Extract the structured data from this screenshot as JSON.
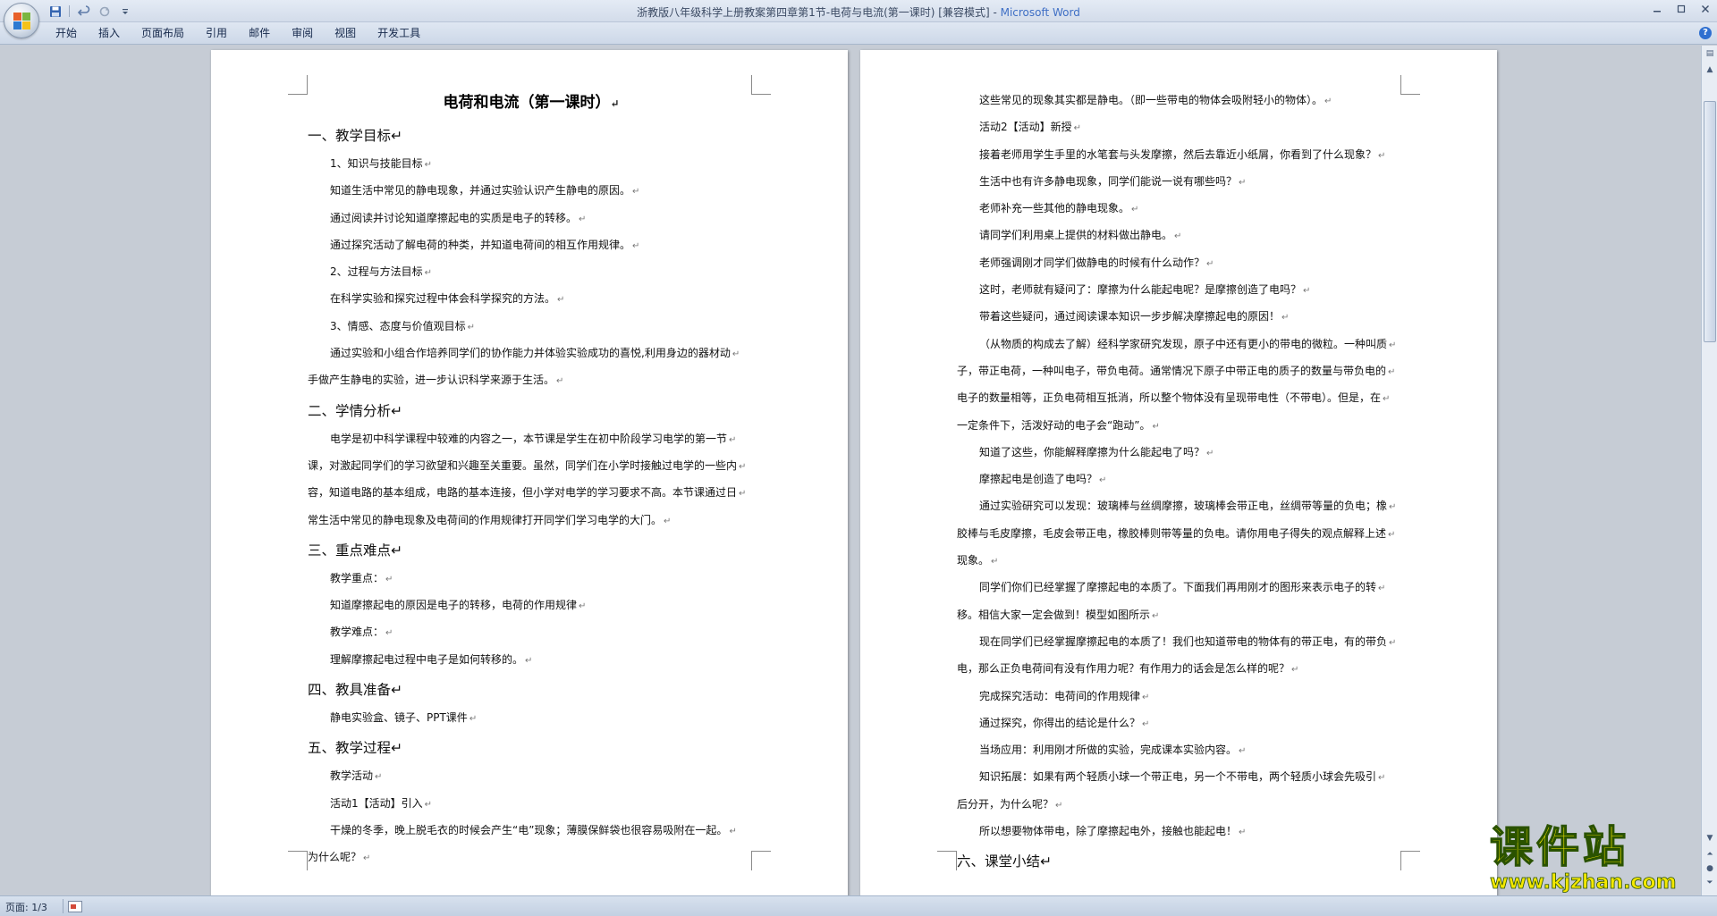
{
  "window": {
    "doc_title": "浙教版八年级科学上册教案第四章第1节-电荷与电流(第一课时) [兼容模式] - ",
    "app_name": "Microsoft Word",
    "help_glyph": "?"
  },
  "qat": {
    "save_icon": "save-icon",
    "undo_icon": "undo-icon",
    "redo_icon": "redo-icon",
    "customize_icon": "dropdown-icon"
  },
  "ribbon": {
    "tabs": [
      "开始",
      "插入",
      "页面布局",
      "引用",
      "邮件",
      "审阅",
      "视图",
      "开发工具"
    ]
  },
  "page1": {
    "title": "电荷和电流（第一课时）",
    "lines": [
      {
        "cls": "h1",
        "text": "一、教学目标"
      },
      {
        "cls": "p ind",
        "text": "1、知识与技能目标"
      },
      {
        "cls": "p ind",
        "text": "知道生活中常见的静电现象，并通过实验认识产生静电的原因。"
      },
      {
        "cls": "p ind",
        "text": "通过阅读并讨论知道摩擦起电的实质是电子的转移。"
      },
      {
        "cls": "p ind",
        "text": "通过探究活动了解电荷的种类，并知道电荷间的相互作用规律。"
      },
      {
        "cls": "p ind",
        "text": "2、过程与方法目标"
      },
      {
        "cls": "p ind",
        "text": "在科学实验和探究过程中体会科学探究的方法。"
      },
      {
        "cls": "p ind",
        "text": "3、情感、态度与价值观目标"
      },
      {
        "cls": "p ind",
        "text": "通过实验和小组合作培养同学们的协作能力并体验实验成功的喜悦,利用身边的器材动"
      },
      {
        "cls": "p",
        "text": "手做产生静电的实验，进一步认识科学来源于生活。"
      },
      {
        "cls": "h1 pad",
        "text": "二、学情分析"
      },
      {
        "cls": "p ind",
        "text": "电学是初中科学课程中较难的内容之一，本节课是学生在初中阶段学习电学的第一节"
      },
      {
        "cls": "p",
        "text": "课，对激起同学们的学习欲望和兴趣至关重要。虽然，同学们在小学时接触过电学的一些内"
      },
      {
        "cls": "p",
        "text": "容，知道电路的基本组成，电路的基本连接，但小学对电学的学习要求不高。本节课通过日"
      },
      {
        "cls": "p",
        "text": "常生活中常见的静电现象及电荷间的作用规律打开同学们学习电学的大门。"
      },
      {
        "cls": "h1 pad",
        "text": "三、重点难点"
      },
      {
        "cls": "p ind",
        "text": "教学重点："
      },
      {
        "cls": "p ind",
        "text": "知道摩擦起电的原因是电子的转移，电荷的作用规律"
      },
      {
        "cls": "p ind",
        "text": "教学难点："
      },
      {
        "cls": "p ind",
        "text": "理解摩擦起电过程中电子是如何转移的。"
      },
      {
        "cls": "h1 pad",
        "text": "四、教具准备"
      },
      {
        "cls": "p ind",
        "text": "静电实验盒、镜子、PPT课件"
      },
      {
        "cls": "h1 pad",
        "text": "五、教学过程"
      },
      {
        "cls": "p ind",
        "text": "教学活动"
      },
      {
        "cls": "p ind",
        "text": "活动1【活动】引入"
      },
      {
        "cls": "p ind",
        "text": "干燥的冬季，晚上脱毛衣的时候会产生“电”现象；薄膜保鲜袋也很容易吸附在一起。"
      },
      {
        "cls": "p",
        "text": "为什么呢？"
      }
    ]
  },
  "page2": {
    "lines": [
      {
        "cls": "p ind",
        "text": "这些常见的现象其实都是静电。（即一些带电的物体会吸附轻小的物体）。"
      },
      {
        "cls": "p ind",
        "text": "活动2【活动】新授"
      },
      {
        "cls": "p ind",
        "text": "接着老师用学生手里的水笔套与头发摩擦，然后去靠近小纸屑，你看到了什么现象？"
      },
      {
        "cls": "p ind",
        "text": "生活中也有许多静电现象，同学们能说一说有哪些吗？"
      },
      {
        "cls": "p ind",
        "text": "老师补充一些其他的静电现象。"
      },
      {
        "cls": "p ind",
        "text": "请同学们利用桌上提供的材料做出静电。"
      },
      {
        "cls": "p ind",
        "text": "老师强调刚才同学们做静电的时候有什么动作？"
      },
      {
        "cls": "p ind",
        "text": "这时，老师就有疑问了：摩擦为什么能起电呢？是摩擦创造了电吗？"
      },
      {
        "cls": "p ind",
        "text": "带着这些疑问，通过阅读课本知识一步步解决摩擦起电的原因！"
      },
      {
        "cls": "p ind",
        "text": "（从物质的构成去了解）经科学家研究发现，原子中还有更小的带电的微粒。一种叫质"
      },
      {
        "cls": "p",
        "text": "子，带正电荷，一种叫电子，带负电荷。通常情况下原子中带正电的质子的数量与带负电的"
      },
      {
        "cls": "p",
        "text": "电子的数量相等，正负电荷相互抵消，所以整个物体没有呈现带电性（不带电）。但是，在"
      },
      {
        "cls": "p",
        "text": "一定条件下，活泼好动的电子会“跑动”。"
      },
      {
        "cls": "p ind",
        "text": "知道了这些，你能解释摩擦为什么能起电了吗？"
      },
      {
        "cls": "p ind",
        "text": "摩擦起电是创造了电吗？"
      },
      {
        "cls": "p ind",
        "text": "通过实验研究可以发现：玻璃棒与丝绸摩擦，玻璃棒会带正电，丝绸带等量的负电；橡"
      },
      {
        "cls": "p",
        "text": "胶棒与毛皮摩擦，毛皮会带正电，橡胶棒则带等量的负电。请你用电子得失的观点解释上述"
      },
      {
        "cls": "p",
        "text": "现象。"
      },
      {
        "cls": "p ind",
        "text": "同学们你们已经掌握了摩擦起电的本质了。下面我们再用刚才的图形来表示电子的转"
      },
      {
        "cls": "p",
        "text": "移。相信大家一定会做到！模型如图所示"
      },
      {
        "cls": "p ind",
        "text": "现在同学们已经掌握摩擦起电的本质了！我们也知道带电的物体有的带正电，有的带负"
      },
      {
        "cls": "p",
        "text": "电，那么正负电荷间有没有作用力呢？有作用力的话会是怎么样的呢？"
      },
      {
        "cls": "p ind",
        "text": "完成探究活动：电荷间的作用规律"
      },
      {
        "cls": "p ind",
        "text": "通过探究，你得出的结论是什么？"
      },
      {
        "cls": "p ind",
        "text": "当场应用：利用刚才所做的实验，完成课本实验内容。"
      },
      {
        "cls": "p ind",
        "text": " 知识拓展：如果有两个轻质小球一个带正电，另一个不带电，两个轻质小球会先吸引"
      },
      {
        "cls": "p",
        "text": "后分开，为什么呢？"
      },
      {
        "cls": "p ind",
        "text": "所以想要物体带电，除了摩擦起电外，接触也能起电！"
      },
      {
        "cls": "h1 pad",
        "text": "六、课堂小结"
      }
    ]
  },
  "status": {
    "page_label": "页面: 1/3"
  },
  "watermark": {
    "main": "课件站",
    "url": "www.kjzhan.com"
  }
}
